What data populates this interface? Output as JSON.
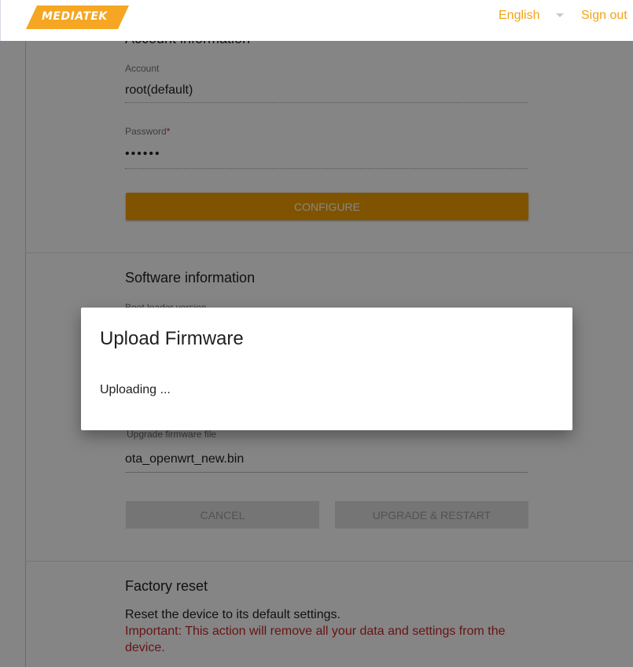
{
  "header": {
    "logo_text": "MEDIATEK",
    "language": "English",
    "sign_out": "Sign out",
    "colors": {
      "accent": "#f2a21a",
      "logo": "#f5a623"
    }
  },
  "account": {
    "title": "Account information",
    "account_label": "Account",
    "account_value": "root(default)",
    "password_label": "Password",
    "password_required": "*",
    "password_value": "••••••",
    "configure_label": "CONFIGURE"
  },
  "software": {
    "title": "Software information",
    "bootloader_label": "Boot loader version",
    "upgrade_file_label": "Upgrade firmware file",
    "upgrade_file_value": "ota_openwrt_new.bin",
    "cancel_label": "CANCEL",
    "upgrade_label": "UPGRADE & RESTART"
  },
  "factory": {
    "title": "Factory reset",
    "description": "Reset the device to its default settings.",
    "warning": "Important: This action will remove all your data and settings from the device."
  },
  "dialog": {
    "title": "Upload Firmware",
    "message": "Uploading ..."
  }
}
